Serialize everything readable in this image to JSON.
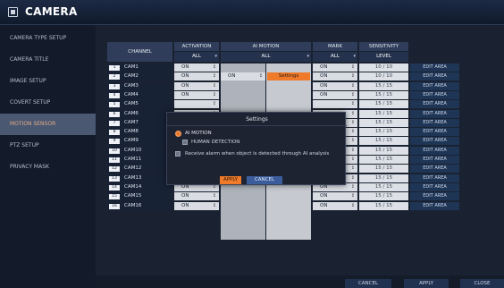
{
  "header": {
    "title": "CAMERA"
  },
  "sidebar": {
    "items": [
      {
        "label": "CAMERA TYPE SETUP"
      },
      {
        "label": "CAMERA TITLE"
      },
      {
        "label": "IMAGE SETUP"
      },
      {
        "label": "COVERT SETUP"
      },
      {
        "label": "MOTION SENSOR",
        "active": true
      },
      {
        "label": "PTZ SETUP"
      },
      {
        "label": "PRIVACY MASK"
      }
    ]
  },
  "table": {
    "headers": {
      "channel": "CHANNEL",
      "activation": "ACTIVATION",
      "ai_motion": "AI MOTION",
      "mark": "MARK",
      "sensitivity": "SENSITIVITY"
    },
    "subheaders": {
      "activation": "ALL",
      "ai_motion": "ALL",
      "mark": "ALL",
      "sensitivity": "LEVEL"
    },
    "rows": [
      {
        "num": "1",
        "name": "CAM1",
        "activation": "ON",
        "mark": "ON",
        "sensitivity": "10 / 10",
        "edit": "EDIT AREA"
      },
      {
        "num": "2",
        "name": "CAM2",
        "activation": "ON",
        "ai": "ON",
        "ai_button": "Settings",
        "mark": "ON",
        "sensitivity": "10 / 10",
        "edit": "EDIT AREA"
      },
      {
        "num": "3",
        "name": "CAM3",
        "activation": "ON",
        "mark": "ON",
        "sensitivity": "15 / 15",
        "edit": "EDIT AREA"
      },
      {
        "num": "4",
        "name": "CAM4",
        "activation": "ON",
        "mark": "ON",
        "sensitivity": "15 / 15",
        "edit": "EDIT AREA"
      },
      {
        "num": "5",
        "name": "CAM5",
        "activation": "",
        "mark": "",
        "sensitivity": "15 / 15",
        "edit": "EDIT AREA"
      },
      {
        "num": "6",
        "name": "CAM6",
        "activation": "",
        "mark": "",
        "sensitivity": "15 / 15",
        "edit": "EDIT AREA"
      },
      {
        "num": "7",
        "name": "CAM7",
        "activation": "",
        "mark": "",
        "sensitivity": "15 / 15",
        "edit": "EDIT AREA"
      },
      {
        "num": "8",
        "name": "CAM8",
        "activation": "",
        "mark": "",
        "sensitivity": "15 / 15",
        "edit": "EDIT AREA"
      },
      {
        "num": "9",
        "name": "CAM9",
        "activation": "",
        "mark": "",
        "sensitivity": "15 / 15",
        "edit": "EDIT AREA"
      },
      {
        "num": "10",
        "name": "CAM10",
        "activation": "",
        "mark": "",
        "sensitivity": "15 / 15",
        "edit": "EDIT AREA"
      },
      {
        "num": "11",
        "name": "CAM11",
        "activation": "",
        "mark": "",
        "sensitivity": "15 / 15",
        "edit": "EDIT AREA"
      },
      {
        "num": "12",
        "name": "CAM12",
        "activation": "ON",
        "mark": "ON",
        "sensitivity": "15 / 15",
        "edit": "EDIT AREA"
      },
      {
        "num": "13",
        "name": "CAM13",
        "activation": "ON",
        "mark": "ON",
        "sensitivity": "15 / 15",
        "edit": "EDIT AREA"
      },
      {
        "num": "14",
        "name": "CAM14",
        "activation": "ON",
        "mark": "ON",
        "sensitivity": "15 / 15",
        "edit": "EDIT AREA"
      },
      {
        "num": "15",
        "name": "CAM15",
        "activation": "ON",
        "mark": "ON",
        "sensitivity": "15 / 15",
        "edit": "EDIT AREA"
      },
      {
        "num": "16",
        "name": "CAM16",
        "activation": "ON",
        "mark": "ON",
        "sensitivity": "15 / 15",
        "edit": "EDIT AREA"
      }
    ]
  },
  "modal": {
    "title": "Settings",
    "ai_motion_label": "AI MOTION",
    "human_detection_label": "HUMAN DETECTION",
    "receive_alarm_label": "Receive alarm when object is detected through AI analysis",
    "apply_label": "APPLY",
    "cancel_label": "CANCEL"
  },
  "footer": {
    "cancel_label": "CANCEL",
    "apply_label": "APPLY",
    "close_label": "CLOSE"
  },
  "colors": {
    "accent": "#ee7a2a",
    "active_menu_text": "#e3ab87",
    "header_bg": "#2f3d5a"
  },
  "icons": {
    "logo": "camera-menu-icon",
    "dropdown": "chevron-down-icon"
  }
}
